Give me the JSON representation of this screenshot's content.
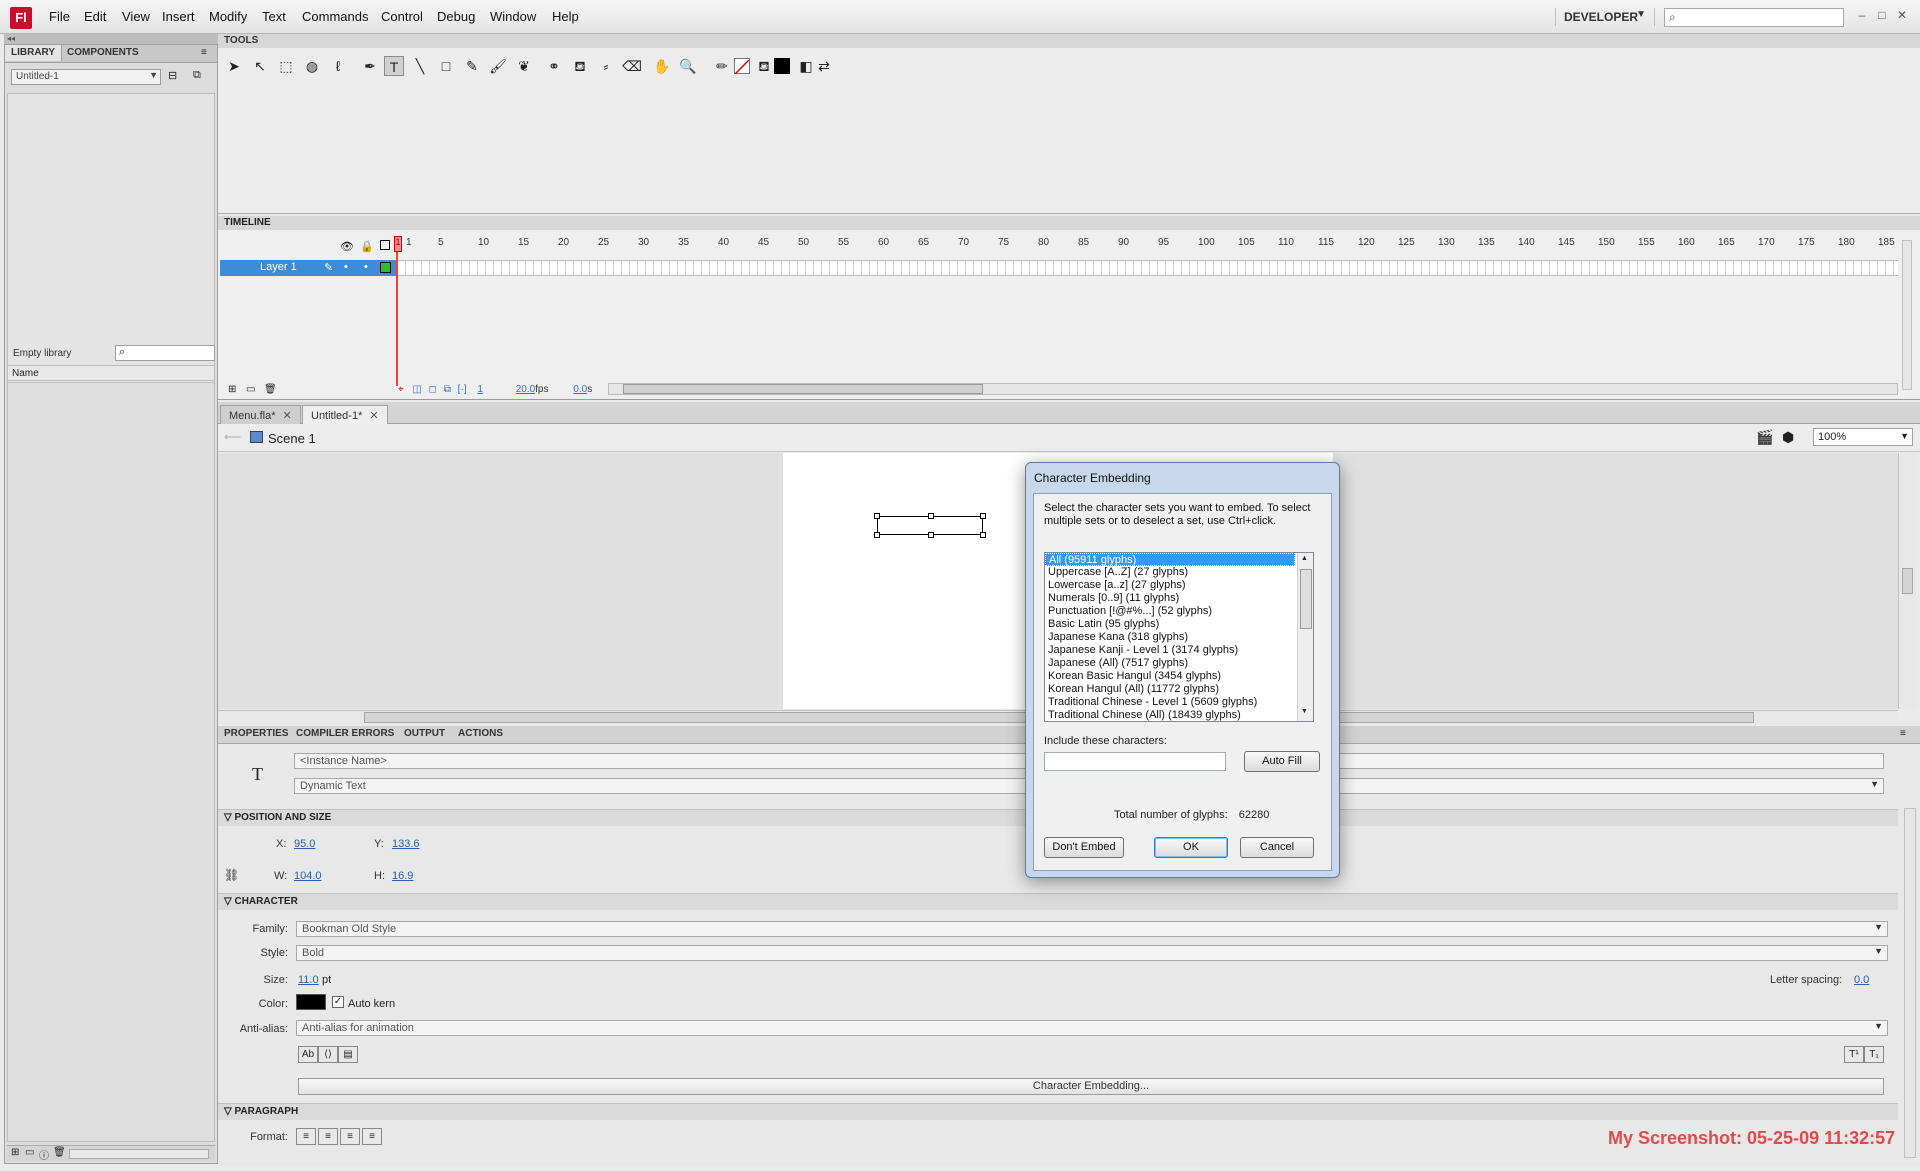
{
  "app": {
    "logo": "Fl"
  },
  "menu": [
    "File",
    "Edit",
    "View",
    "Insert",
    "Modify",
    "Text",
    "Commands",
    "Control",
    "Debug",
    "Window",
    "Help"
  ],
  "workspace": {
    "label": "DEVELOPER"
  },
  "window_controls": {
    "minimize": "–",
    "maximize": "□",
    "close": "✕"
  },
  "library": {
    "tabs": [
      "LIBRARY",
      "COMPONENTS"
    ],
    "doc_select": "Untitled-1",
    "count_label": "Empty library",
    "col_name": "Name"
  },
  "tools": {
    "title": "TOOLS",
    "icons": [
      "selection-icon",
      "subselection-icon",
      "free-transform-icon",
      "3d-rotation-icon",
      "lasso-icon",
      "pen-icon",
      "text-icon",
      "line-icon",
      "rectangle-icon",
      "pencil-icon",
      "brush-icon",
      "deco-icon",
      "bone-icon",
      "paint-bucket-icon",
      "eyedropper-icon",
      "eraser-icon",
      "hand-icon",
      "zoom-icon",
      "stroke-color-icon",
      "fill-color-icon",
      "swap-colors-icon"
    ]
  },
  "timeline": {
    "title": "TIMELINE",
    "ticks": [
      "1",
      "5",
      "10",
      "15",
      "20",
      "25",
      "30",
      "35",
      "40",
      "45",
      "50",
      "55",
      "60",
      "65",
      "70",
      "75",
      "80",
      "85",
      "90",
      "95",
      "100",
      "105",
      "110",
      "115",
      "120",
      "125",
      "130",
      "135",
      "140",
      "145",
      "150",
      "155",
      "160",
      "165",
      "170",
      "175",
      "180",
      "185"
    ],
    "layer_name": "Layer 1",
    "current_frame": "1",
    "fps": "20.0",
    "fps_unit": "fps",
    "time": "0.0",
    "time_unit": "s"
  },
  "doc_tabs": [
    {
      "label": "Menu.fla*",
      "active": false
    },
    {
      "label": "Untitled-1*",
      "active": true
    }
  ],
  "scene": {
    "label": "Scene 1",
    "zoom": "100%"
  },
  "properties": {
    "tabs": [
      "PROPERTIES",
      "COMPILER ERRORS",
      "OUTPUT",
      "ACTIONS"
    ],
    "instance_name_placeholder": "<Instance Name>",
    "text_type": "Dynamic Text",
    "position_section": "POSITION AND SIZE",
    "x_label": "X:",
    "x": "95.0",
    "y_label": "Y:",
    "y": "133.6",
    "w_label": "W:",
    "w": "104.0",
    "h_label": "H:",
    "h": "16.9",
    "character_section": "CHARACTER",
    "family_label": "Family:",
    "family": "Bookman Old Style",
    "style_label": "Style:",
    "style": "Bold",
    "size_label": "Size:",
    "size": "11.0",
    "size_unit": "pt",
    "letter_spacing_label": "Letter spacing:",
    "letter_spacing": "0.0",
    "color_label": "Color:",
    "auto_kern": "Auto kern",
    "antialias_label": "Anti-alias:",
    "antialias": "Anti-alias for animation",
    "char_embed_button": "Character Embedding...",
    "paragraph_section": "PARAGRAPH",
    "format_label": "Format:"
  },
  "dialog": {
    "title": "Character Embedding",
    "instructions": "Select the character sets you want to embed. To select multiple sets or to deselect a set, use Ctrl+click.",
    "items": [
      "All  (95911 glyphs)",
      "Uppercase [A..Z]  (27 glyphs)",
      "Lowercase [a..z]  (27 glyphs)",
      "Numerals [0..9]  (11 glyphs)",
      "Punctuation [!@#%...]  (52 glyphs)",
      "Basic Latin  (95 glyphs)",
      "Japanese Kana  (318 glyphs)",
      "Japanese Kanji - Level 1 (3174 glyphs)",
      "Japanese (All)  (7517 glyphs)",
      "Korean Basic Hangul (3454 glyphs)",
      "Korean Hangul (All) (11772 glyphs)",
      "Traditional Chinese - Level 1 (5609 glyphs)",
      "Traditional Chinese (All)  (18439 glyphs)"
    ],
    "selected_index": 0,
    "include_label": "Include these characters:",
    "auto_fill": "Auto Fill",
    "total_label": "Total number of glyphs:",
    "total_value": "62280",
    "dont_embed": "Don't Embed",
    "ok": "OK",
    "cancel": "Cancel"
  },
  "stamp": "My Screenshot: 05-25-09 11:32:57",
  "colors": {
    "accent": "#3c8cd7",
    "stamp": "#e14b4b",
    "logo": "#c8102e"
  }
}
